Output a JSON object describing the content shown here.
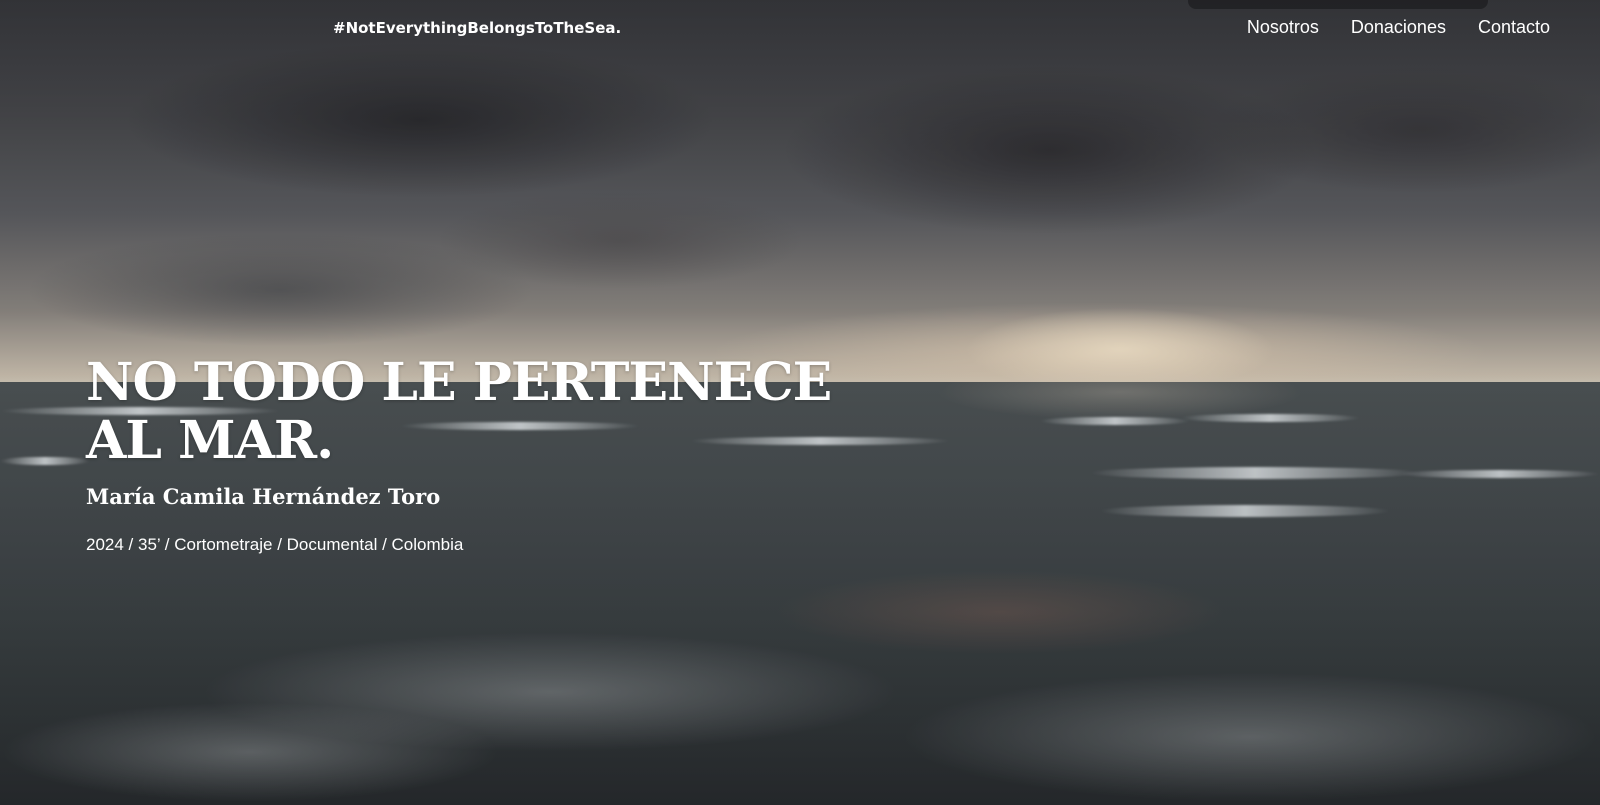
{
  "header": {
    "tagline": "#NotEverythingBelongsToTheSea.",
    "nav": [
      {
        "label": "Nosotros"
      },
      {
        "label": "Donaciones"
      },
      {
        "label": "Contacto"
      }
    ]
  },
  "hero": {
    "title_line1": "NO TODO LE PERTENECE",
    "title_line2": "AL MAR.",
    "director": "María Camila Hernández Toro",
    "meta": "2024 / 35’ / Cortometraje / Documental / Colombia"
  },
  "colors": {
    "text": "#ffffff",
    "sky": "#4a4b4f",
    "sea": "#3d4346",
    "horizon_glow": "#e8dccb"
  }
}
